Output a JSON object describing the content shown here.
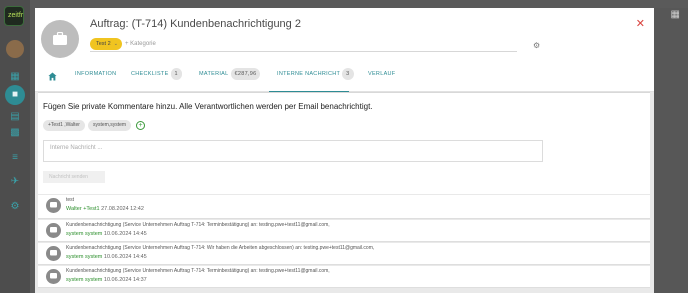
{
  "colors": {
    "accent": "#2e8c94",
    "tag": "#f0c420",
    "close": "#d9423d",
    "author": "#2c8f2c"
  },
  "rail": {
    "logo_text": "zeitfr",
    "icons": [
      "calendar-icon",
      "briefcase-icon",
      "document-icon",
      "dashboard-icon",
      "sliders-icon",
      "plane-icon",
      "gear-icon"
    ]
  },
  "modal": {
    "title": "Auftrag: (T-714) Kundenbenachrichtigung 2",
    "tag_label": "Test 2",
    "category_placeholder": "+ Kategorie",
    "tabs": [
      {
        "label": "INFORMATION",
        "badge": ""
      },
      {
        "label": "CHECKLISTE",
        "badge": "1"
      },
      {
        "label": "MATERIAL",
        "badge": "€287,96"
      },
      {
        "label": "INTERNE NACHRICHT",
        "badge": "3"
      },
      {
        "label": "VERLAUF",
        "badge": ""
      }
    ]
  },
  "comment": {
    "heading": "Fügen Sie private Kommentare hinzu. Alle Verantwortlichen werden per Email benachrichtigt.",
    "people": [
      "+Test1 ,Walter",
      "system,system"
    ],
    "input_placeholder": "Interne Nachricht ...",
    "send_label": "Nachricht senden"
  },
  "history": [
    {
      "text": "test",
      "author": "Walter +Test1",
      "date": "27.08.2024 12:42"
    },
    {
      "text": "Kundenbenachrichtigung (Service Unternehmen Auftrag T-714: Terminbestätigung) an: testing.pwe+test11@gmail.com,",
      "author": "system system",
      "date": "10.06.2024 14:45"
    },
    {
      "text": "Kundenbenachrichtigung (Service Unternehmen Auftrag T-714: Wir haben die Arbeiten abgeschlossen) an: testing.pwe+test11@gmail.com,",
      "author": "system system",
      "date": "10.06.2024 14:45"
    },
    {
      "text": "Kundenbenachrichtigung (Service Unternehmen Auftrag T-714: Terminbestätigung) an: testing.pwe+test11@gmail.com,",
      "author": "system system",
      "date": "10.06.2024 14:37"
    }
  ]
}
